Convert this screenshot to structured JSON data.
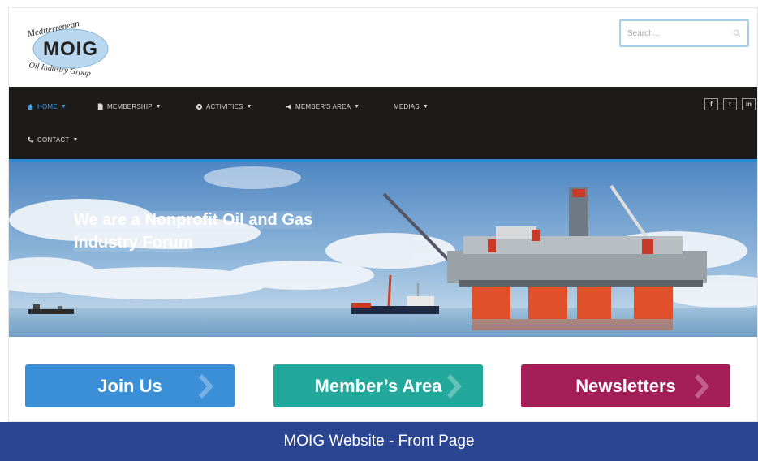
{
  "logo": {
    "line1": "Mediterrenean",
    "line2": "MOIG",
    "line3": "Oil Industry Group"
  },
  "search": {
    "placeholder": "Search..."
  },
  "nav": {
    "items": [
      {
        "label": "HOME",
        "icon": "home-icon",
        "active": true
      },
      {
        "label": "MEMBERSHIP",
        "icon": "document-icon"
      },
      {
        "label": "ACTIVITIES",
        "icon": "gear-icon"
      },
      {
        "label": "MEMBER'S AREA",
        "icon": "megaphone-icon"
      },
      {
        "label": "MEDIAS",
        "icon": ""
      },
      {
        "label": "CONTACT",
        "icon": "phone-icon"
      }
    ],
    "social": [
      {
        "label": "f",
        "icon": "facebook-icon"
      },
      {
        "label": "t",
        "icon": "twitter-icon"
      },
      {
        "label": "in",
        "icon": "linkedin-icon"
      }
    ],
    "active_color": "#3fa0e6",
    "bar_color": "#1d1b1a",
    "accent_color": "#2a8ad6"
  },
  "hero": {
    "title_line1": "We are a Nonprofit Oil and Gas",
    "title_line2": "Industry Forum"
  },
  "cta": {
    "join": {
      "label": "Join Us",
      "color": "#3b8fd6"
    },
    "member": {
      "label": "Member’s Area",
      "color": "#22a99b"
    },
    "news": {
      "label": "Newsletters",
      "color": "#a41e58"
    }
  },
  "caption": {
    "text": "MOIG Website - Front Page",
    "color": "#2c4592"
  }
}
